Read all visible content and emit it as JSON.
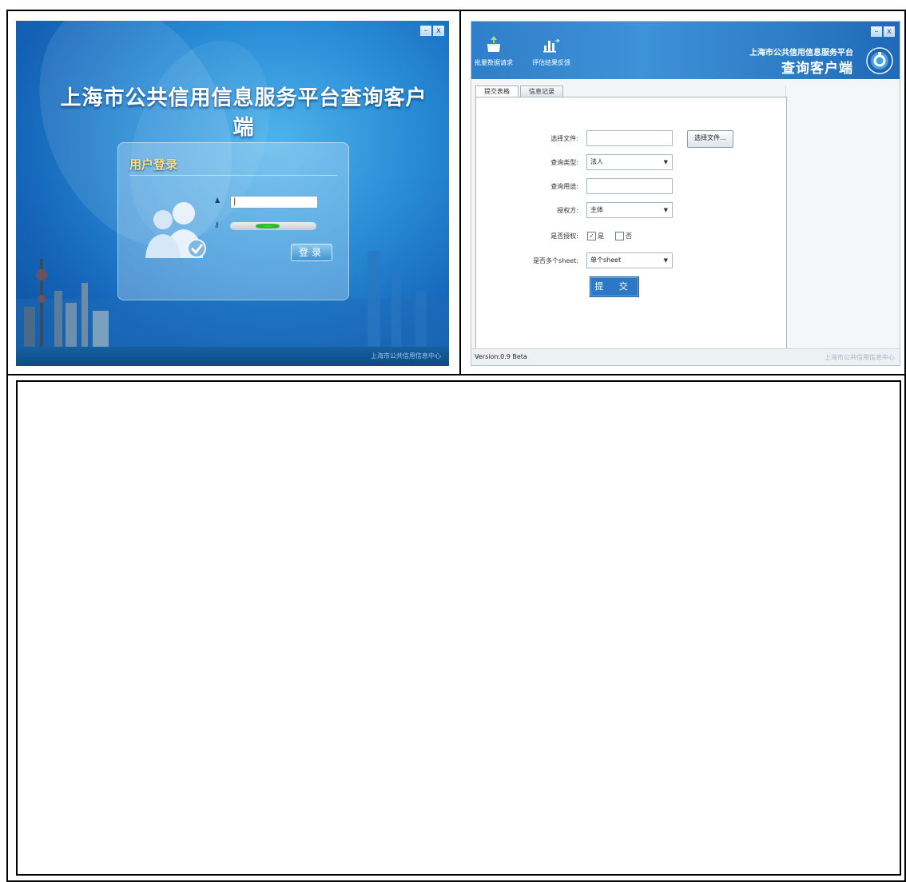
{
  "login": {
    "title": "上海市公共信用信息服务平台查询客户端",
    "panel_title": "用户登录",
    "username_value": "|",
    "login_button": "登录",
    "footer": "上海市公共信用信息中心",
    "window_buttons": {
      "minimize": "–",
      "close": "x"
    },
    "progress_fraction": 0.3
  },
  "client": {
    "toolbar": [
      {
        "label": "批量数据请求",
        "icon": "upload-tray-icon"
      },
      {
        "label": "评估结果反馈",
        "icon": "bar-chart-icon"
      }
    ],
    "brand_line1": "上海市公共信用信息服务平台",
    "brand_line2": "查询客户端",
    "tabs": [
      {
        "label": "提交表格",
        "active": true
      },
      {
        "label": "信息记录",
        "active": false
      }
    ],
    "form": {
      "file_label": "选择文件:",
      "file_value": "",
      "choose_file_button": "选择文件...",
      "query_type_label": "查询类型:",
      "query_type_value": "法人",
      "purpose_label": "查询用途:",
      "purpose_value": "",
      "authorizer_label": "授权方:",
      "authorizer_value": "主体",
      "authorized_label": "是否授权:",
      "yes_label": "是",
      "yes_checked": true,
      "no_label": "否",
      "no_checked": false,
      "multi_sheet_label": "是否多个sheet:",
      "multi_sheet_value": "单个sheet",
      "submit_button": "提 交"
    },
    "status_version": "Version:0.9 Beta",
    "status_org": "上海市公共信用信息中心",
    "window_buttons": {
      "minimize": "–",
      "close": "x"
    }
  }
}
